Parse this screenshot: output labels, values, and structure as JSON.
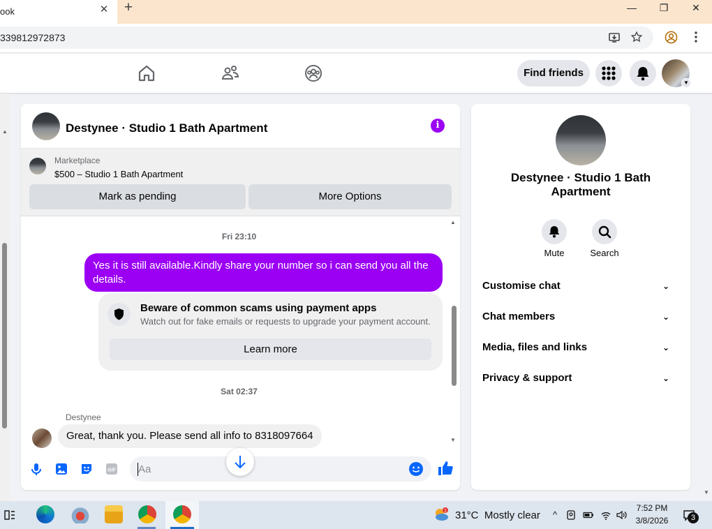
{
  "browser": {
    "tab_title": "ook",
    "tab_close": "✕",
    "new_tab": "+",
    "url": "339812972873",
    "window_min": "—",
    "window_restore": "❐",
    "window_close": "✕"
  },
  "fb_nav": {
    "find_friends": "Find friends",
    "icons": [
      "home-icon",
      "friends-icon",
      "groups-icon",
      "menu-grid-icon",
      "notifications-bell-icon",
      "profile-avatar"
    ]
  },
  "chat": {
    "title": "Destynee · Studio 1 Bath Apartment",
    "info_glyph": "i",
    "marketplace_label": "Marketplace",
    "listing": "$500 – Studio 1 Bath Apartment",
    "mark_pending": "Mark as pending",
    "more_options": "More Options",
    "timestamp1": "Fri 23:10",
    "sent_message": "Yes it is still available.Kindly share your number so i can send you all the details.",
    "scam_title": "Beware of common scams using payment apps",
    "scam_sub": "Watch out for fake emails or requests to upgrade your payment account.",
    "learn_more": "Learn more",
    "timestamp2": "Sat 02:37",
    "sender_name": "Destynee",
    "received_message": "Great, thank you. Please send all info to 8318097664",
    "input_placeholder": "Aa",
    "accent_color": "#9b00f4"
  },
  "info_panel": {
    "title": "Destynee · Studio 1 Bath Apartment",
    "mute": "Mute",
    "search": "Search",
    "rows": [
      "Customise chat",
      "Chat members",
      "Media, files and links",
      "Privacy & support"
    ],
    "chevron": "⌄"
  },
  "taskbar": {
    "weather_badge": "1",
    "temperature": "31°C",
    "weather_text": "Mostly clear",
    "time": "7:52 PM",
    "date": "3/8/2026",
    "notification_count": "3"
  }
}
